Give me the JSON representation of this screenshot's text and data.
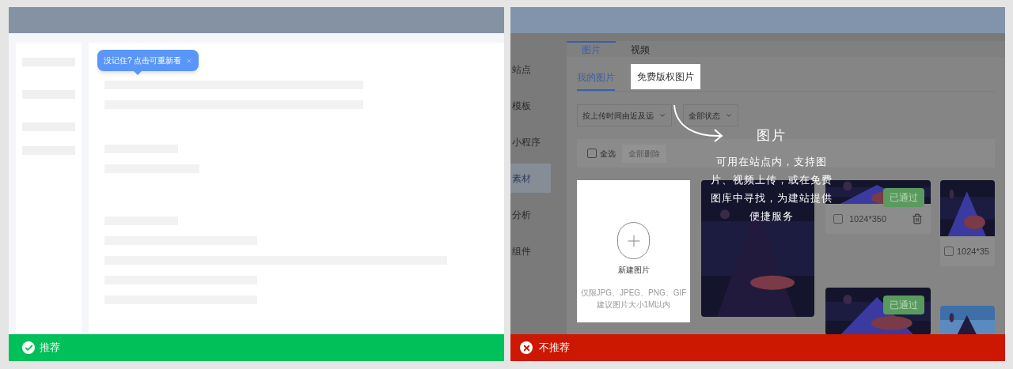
{
  "verdicts": [
    {
      "kind": "good",
      "label": "推荐"
    },
    {
      "kind": "bad",
      "label": "不推荐"
    }
  ],
  "good_example": {
    "tooltip": {
      "text": "没记住? 点击可重新看"
    }
  },
  "bad_example": {
    "sidebar": [
      {
        "label": "站点",
        "selected": false
      },
      {
        "label": "模板",
        "selected": false
      },
      {
        "label": "小程序",
        "selected": false
      },
      {
        "label": "素材",
        "selected": true
      },
      {
        "label": "分析",
        "selected": false
      },
      {
        "label": "组件",
        "selected": false
      }
    ],
    "tabs": [
      {
        "label": "图片",
        "selected": true
      },
      {
        "label": "视频",
        "selected": false
      }
    ],
    "subtabs": [
      {
        "label": "我的图片",
        "selected": true,
        "highlighted": false
      },
      {
        "label": "免费版权图片",
        "selected": false,
        "highlighted": true
      }
    ],
    "filters": [
      "按上传时间由近及远",
      "全部状态"
    ],
    "select_all": {
      "label": "全选",
      "checked": false
    },
    "delete_button": {
      "label": "全部删除",
      "disabled": true
    },
    "new_card": {
      "title": "新建图片",
      "hints": [
        "仅限JPG、JPEG、PNG、GIF",
        "建议图片大小1M以内"
      ]
    },
    "columns": [
      [
        {
          "kind": "picture"
        }
      ],
      [
        {
          "kind": "item",
          "badge": "已通过",
          "size": "1024*350",
          "checked": false
        },
        {
          "kind": "picture",
          "badge": "已通过"
        }
      ],
      [
        {
          "kind": "item",
          "size": "1024*35",
          "checked": false
        },
        {
          "kind": "picture"
        }
      ]
    ],
    "guide": {
      "title": "图片",
      "lines": [
        "可用在站点内，支持图",
        "片、视频上传，或在免费",
        "图库中寻找，为建站提供",
        "便捷服务"
      ]
    }
  }
}
